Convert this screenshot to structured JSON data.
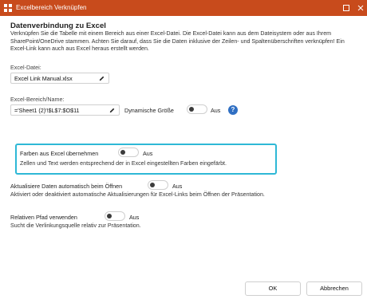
{
  "window": {
    "title": "Excelbereich Verknüpfen"
  },
  "section": {
    "heading": "Datenverbindung zu Excel",
    "description": "Verknüpfen Sie die Tabelle mit einem Bereich aus einer Excel-Datei. Die Excel-Datei kann aus dem Dateisystem oder aus Ihrem SharePoint/OneDrive stammen. Achten Sie darauf, dass Sie die Daten inklusive der Zeilen- und Spaltenüberschriften verknüpfen! Ein Excel-Link kann auch aus Excel heraus erstellt werden."
  },
  "excel_file": {
    "label": "Excel-Datei:",
    "value": "Excel Link Manual.xlsx"
  },
  "excel_range": {
    "label": "Excel-Bereich/Name:",
    "value": "='Sheet1 (2)'!$L$7:$O$11"
  },
  "dynamic_size": {
    "label": "Dynamische Größe",
    "state": "Aus",
    "help": "?"
  },
  "colors": {
    "label": "Farben aus Excel übernehmen",
    "state": "Aus",
    "description": "Zellen und Text werden entsprechend der in Excel eingestellten Farben eingefärbt."
  },
  "auto_update": {
    "label": "Aktualisiere Daten automatisch beim Öffnen",
    "state": "Aus",
    "description": "Aktiviert oder deaktiviert automatische Aktualisierungen für Excel-Links beim Öffnen der Präsentation."
  },
  "relative_path": {
    "label": "Relativen Pfad verwenden",
    "state": "Aus",
    "description": "Sucht die Verlinkungsquelle relativ zur Präsentation."
  },
  "buttons": {
    "ok": "OK",
    "cancel": "Abbrechen"
  },
  "colors_theme": {
    "titlebar": "#c84b1c",
    "highlight": "#2eb8d6",
    "help": "#2f6fc3"
  }
}
